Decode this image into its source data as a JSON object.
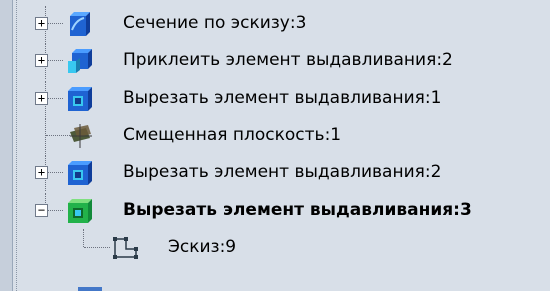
{
  "tree": {
    "items": [
      {
        "label": "Сечение по эскизу:3",
        "expander": "+",
        "icon": "sweep-feature-icon",
        "bold": false
      },
      {
        "label": "Приклеить элемент выдавливания:2",
        "expander": "+",
        "icon": "boss-extrude-icon",
        "bold": false
      },
      {
        "label": "Вырезать элемент выдавливания:1",
        "expander": "+",
        "icon": "cut-extrude-icon",
        "bold": false
      },
      {
        "label": "Смещенная плоскость:1",
        "expander": "",
        "icon": "offset-plane-icon",
        "bold": false
      },
      {
        "label": "Вырезать элемент выдавливания:2",
        "expander": "+",
        "icon": "cut-extrude-icon",
        "bold": false
      },
      {
        "label": "Вырезать элемент выдавливания:3",
        "expander": "−",
        "icon": "cut-extrude-selected-icon",
        "bold": true
      }
    ],
    "child": {
      "label": "Эскиз:9",
      "icon": "sketch-icon"
    }
  },
  "colors": {
    "background": "#d8dfe8",
    "feature_blue": "#2b6fd6",
    "feature_dark": "#123a8a",
    "feature_cyan": "#38c8f0",
    "feature_green": "#22b24a"
  }
}
